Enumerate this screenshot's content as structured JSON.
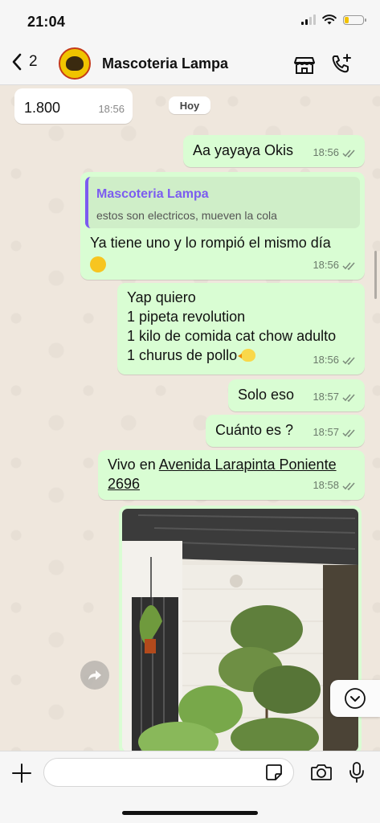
{
  "status_bar": {
    "time": "21:04"
  },
  "header": {
    "back_count": "2",
    "contact_name": "Mascoteria Lampa"
  },
  "chat": {
    "date_divider": "Hoy",
    "messages": [
      {
        "direction": "in",
        "text": "1.800",
        "time": "18:56"
      },
      {
        "direction": "out",
        "text": "Aa yayaya Okis",
        "time": "18:56"
      },
      {
        "direction": "out",
        "quote": {
          "author": "Mascoteria Lampa",
          "text": "estos son electricos, mueven la cola"
        },
        "text": "Ya tiene uno y lo rompió el mismo día",
        "time": "18:56"
      },
      {
        "direction": "out",
        "lines": [
          "Yap quiero",
          "1 pipeta revolution",
          "1 kilo de comida cat chow adulto",
          "1 churus de pollo"
        ],
        "time": "18:56"
      },
      {
        "direction": "out",
        "text": "Solo eso",
        "time": "18:57"
      },
      {
        "direction": "out",
        "text": "Cuánto es ?",
        "time": "18:57"
      },
      {
        "direction": "out",
        "text_prefix": "Vivo en ",
        "link": "Avenida Larapinta Poniente 2696",
        "time": "18:58"
      }
    ]
  },
  "input": {
    "placeholder": ""
  },
  "colors": {
    "outgoing_bubble": "#d9fdd3",
    "incoming_bubble": "#ffffff",
    "quote_accent": "#7c5cf0",
    "read_ticks": "#7b8a7b"
  },
  "icons": [
    "back-chevron-icon",
    "store-icon",
    "add-call-icon",
    "forward-icon",
    "chevron-down-icon",
    "plus-icon",
    "sticker-icon",
    "camera-icon",
    "microphone-icon"
  ]
}
